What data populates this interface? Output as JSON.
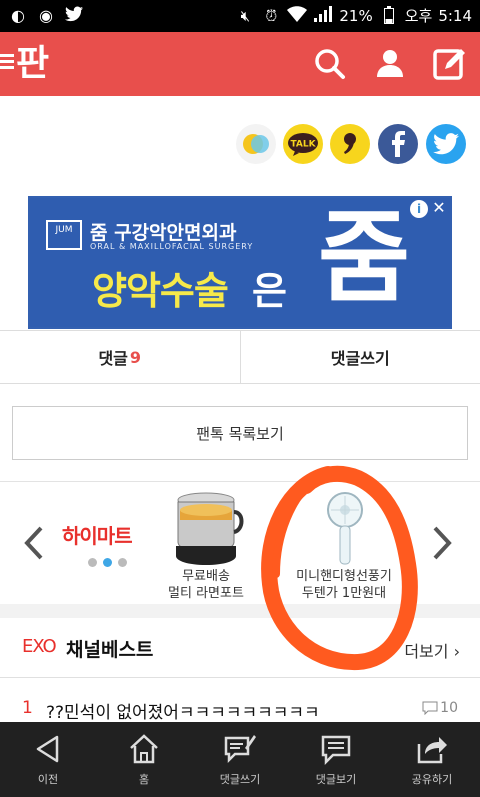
{
  "status_bar": {
    "battery": "21%",
    "ampm": "오후",
    "time": "5:14"
  },
  "header": {
    "logo": "판"
  },
  "ad": {
    "clinic_name": "줌 구강악안면외과",
    "clinic_sub": "ORAL & MAXILLOFACIAL SURGERY",
    "logo_text": "JUM",
    "headline": "양악수술",
    "headline_end": "은",
    "brand": "줌",
    "info": "i",
    "close": "✕"
  },
  "comments": {
    "comment_label": "댓글",
    "comment_count": "9",
    "write_label": "댓글쓰기"
  },
  "list_button": "팬톡 목록보기",
  "carousel": {
    "brand": "하이마트",
    "products": [
      {
        "line1": "무료배송",
        "line2": "멀티 라면포트"
      },
      {
        "line1": "미니핸디형선풍기",
        "line2": "두텐가 1만원대"
      }
    ]
  },
  "channel": {
    "tag": "EXO",
    "title": "채널베스트",
    "more": "더보기"
  },
  "posts": [
    {
      "rank": "1",
      "title": "??민석이 없어졌어ㅋㅋㅋㅋㅋㅋㅋㅋㅋ",
      "comments": "10"
    }
  ],
  "bottom_nav": [
    {
      "label": "이전"
    },
    {
      "label": "홈"
    },
    {
      "label": "댓글쓰기"
    },
    {
      "label": "댓글보기"
    },
    {
      "label": "공유하기"
    }
  ],
  "colors": {
    "brand": "#e84f4c",
    "accent_red": "#e8302c",
    "scribble": "#ff5a1f"
  }
}
